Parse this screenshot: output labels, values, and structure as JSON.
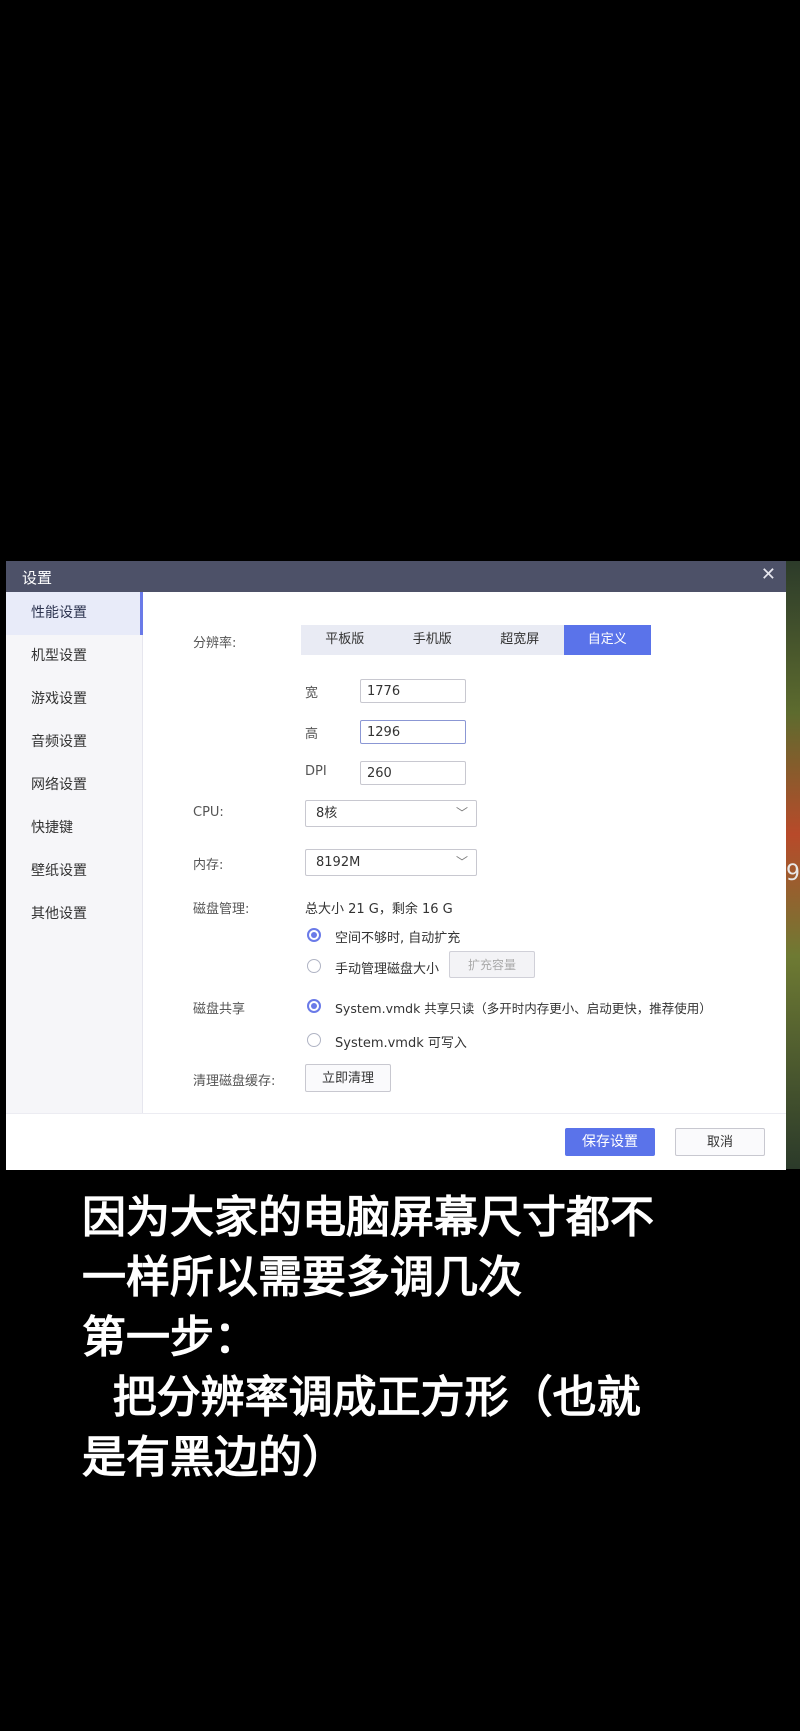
{
  "dialog": {
    "title": "设置",
    "close_icon": "close-icon"
  },
  "sidebar": {
    "items": [
      {
        "label": "性能设置",
        "active": true
      },
      {
        "label": "机型设置"
      },
      {
        "label": "游戏设置"
      },
      {
        "label": "音频设置"
      },
      {
        "label": "网络设置"
      },
      {
        "label": "快捷键"
      },
      {
        "label": "壁纸设置"
      },
      {
        "label": "其他设置"
      }
    ]
  },
  "resolution": {
    "label": "分辨率:",
    "options": [
      "平板版",
      "手机版",
      "超宽屏",
      "自定义"
    ],
    "selected": "自定义",
    "width_label": "宽",
    "width_value": "1776",
    "height_label": "高",
    "height_value": "1296",
    "dpi_label": "DPI",
    "dpi_value": "260"
  },
  "cpu": {
    "label": "CPU:",
    "value": "8核"
  },
  "memory": {
    "label": "内存:",
    "value": "8192M"
  },
  "disk": {
    "label": "磁盘管理:",
    "summary": "总大小 21 G，剩余 16 G",
    "auto_expand": "空间不够时, 自动扩充",
    "manual": "手动管理磁盘大小",
    "expand_button": "扩充容量"
  },
  "disk_share": {
    "label": "磁盘共享",
    "readonly": "System.vmdk 共享只读（多开时内存更小、启动更快，推荐使用）",
    "writable": "System.vmdk 可写入"
  },
  "cache": {
    "label": "清理磁盘缓存:",
    "button": "立即清理"
  },
  "footer": {
    "save": "保存设置",
    "cancel": "取消"
  },
  "caption": "因为大家的电脑屏幕尺寸都不\n一样所以需要多调几次\n第一步：\n  把分辨率调成正方形（也就\n是有黑边的）",
  "colors": {
    "accent": "#5a73ea",
    "titlebar": "#4d5168"
  },
  "right_glyph": "9"
}
